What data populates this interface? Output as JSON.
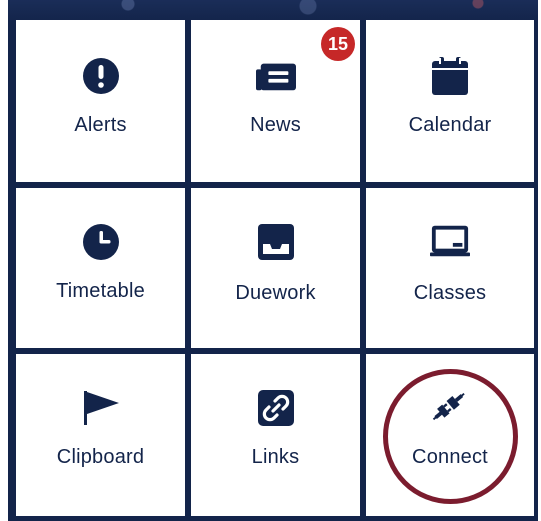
{
  "tiles": [
    {
      "key": "alerts",
      "label": "Alerts",
      "icon": "exclamation-circle-icon"
    },
    {
      "key": "news",
      "label": "News",
      "icon": "newspaper-icon",
      "badge": "15"
    },
    {
      "key": "calendar",
      "label": "Calendar",
      "icon": "calendar-icon"
    },
    {
      "key": "timetable",
      "label": "Timetable",
      "icon": "clock-icon"
    },
    {
      "key": "duework",
      "label": "Duework",
      "icon": "inbox-tray-icon"
    },
    {
      "key": "classes",
      "label": "Classes",
      "icon": "chalkboard-icon"
    },
    {
      "key": "clipboard",
      "label": "Clipboard",
      "icon": "flag-icon"
    },
    {
      "key": "links",
      "label": "Links",
      "icon": "link-icon"
    },
    {
      "key": "connect",
      "label": "Connect",
      "icon": "plug-icon"
    }
  ],
  "colors": {
    "navy": "#13244a",
    "badge": "#c62828",
    "highlight": "#7b1c2e"
  }
}
